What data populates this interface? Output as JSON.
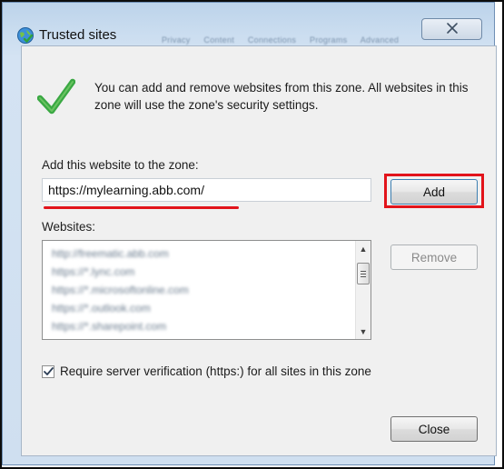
{
  "window": {
    "title": "Trusted sites",
    "close_symbol": "✕",
    "background_tabs": [
      "Privacy",
      "Content",
      "Connections",
      "Programs",
      "Advanced"
    ]
  },
  "info": {
    "text": "You can add and remove websites from this zone. All websites in this zone will use the zone's security settings."
  },
  "add_section": {
    "label": "Add this website to the zone:",
    "url_value": "https://mylearning.abb.com/",
    "add_button": "Add"
  },
  "websites": {
    "label": "Websites:",
    "items": [
      "http://freematic.abb.com",
      "https://*.lync.com",
      "https://*.microsoftonline.com",
      "https://*.outlook.com",
      "https://*.sharepoint.com"
    ],
    "remove_button": "Remove"
  },
  "options": {
    "require_verification_label": "Require server verification (https:) for all sites in this zone",
    "require_verification_checked": true
  },
  "footer": {
    "close_button": "Close"
  },
  "colors": {
    "highlight": "#e2141b",
    "check_green": "#3aa843",
    "window_frame": "#c9dcef"
  },
  "icons": {
    "title_icon": "globe-checkmark-icon",
    "info_icon": "green-checkmark-icon",
    "close_icon": "close-icon"
  }
}
